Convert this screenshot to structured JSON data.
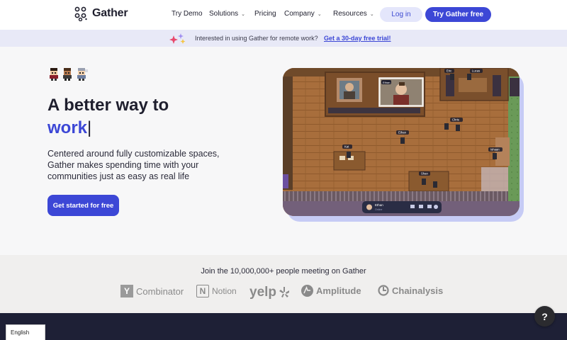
{
  "nav": {
    "brand": "Gather",
    "items": [
      {
        "label": "Try Demo",
        "has_dropdown": false
      },
      {
        "label": "Solutions",
        "has_dropdown": true
      },
      {
        "label": "Pricing",
        "has_dropdown": false
      },
      {
        "label": "Company",
        "has_dropdown": true
      },
      {
        "label": "Resources",
        "has_dropdown": true
      }
    ],
    "login_label": "Log in",
    "cta_label": "Try Gather free"
  },
  "banner": {
    "text": "Interested in using Gather for remote work?",
    "link": "Get a 30-day free trial!"
  },
  "hero": {
    "title_line1": "A better way to",
    "title_word": "work",
    "cursor": "|",
    "description": "Centered around fully customizable spaces, Gather makes spending time with your communities just as easy as real life",
    "cta_label": "Get started for free"
  },
  "game": {
    "name_tags": [
      "Ethan",
      "Chris",
      "Kat",
      "Shan",
      "Lucas",
      "Ishaan",
      "Eric"
    ],
    "toolbar_name": "Ethan",
    "toolbar_status": "Online"
  },
  "logos": {
    "title": "Join the 10,000,000+ people meeting on Gather",
    "brands": [
      "Combinator",
      "Notion",
      "yelp",
      "Amplitude",
      "Chainalysis"
    ],
    "yc_mark": "Y",
    "notion_mark": "N"
  },
  "language": "English",
  "help": "?",
  "colors": {
    "accent": "#3c47d6",
    "accent_light": "#e4e6fb",
    "banner_bg": "#e8e9f7",
    "hero_bg": "#f7f7f8",
    "footer_bg": "#1e2036"
  },
  "icons": [
    "logo-icon",
    "chevron-down-icon",
    "sparkle-icon",
    "help-icon"
  ]
}
